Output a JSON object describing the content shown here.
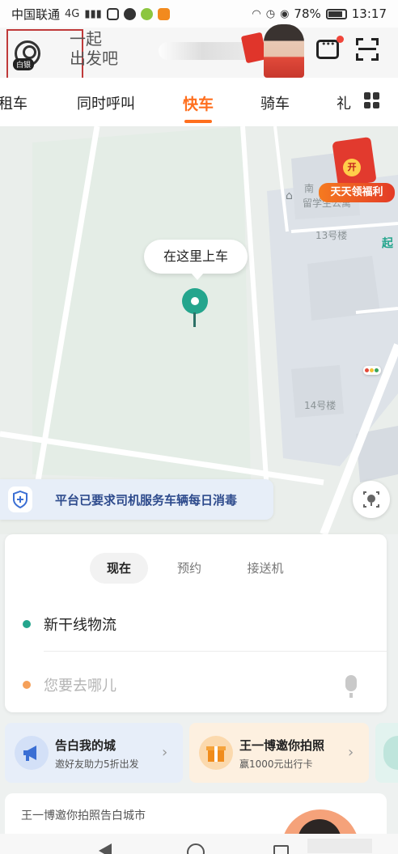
{
  "status_bar": {
    "carrier": "中国联通",
    "network": "4G",
    "battery": "78%",
    "time": "13:17"
  },
  "header": {
    "avatar_badge": "白银",
    "slogan_line1": "一起",
    "slogan_line2": "出发吧"
  },
  "tabs": {
    "items": [
      "租车",
      "同时呼叫",
      "快车",
      "骑车",
      "礼"
    ],
    "active": "快车"
  },
  "map": {
    "welfare_coin": "开",
    "welfare_label": "天天领福利",
    "building_label_1a": "南",
    "building_label_1b": "留学生公寓",
    "building_label_2": "13号楼",
    "building_label_3": "14号楼",
    "start_label": "起",
    "pickup_bubble": "在这里上车",
    "notice_text": "平台已要求司机服务车辆每日消毒"
  },
  "booking": {
    "modes": [
      "现在",
      "预约",
      "接送机"
    ],
    "active_mode": "现在",
    "origin": "新干线物流",
    "destination_placeholder": "您要去哪儿"
  },
  "promos": [
    {
      "title": "告白我的城",
      "subtitle": "邀好友助力5折出发",
      "icon": "megaphone-icon"
    },
    {
      "title": "王一博邀你拍照",
      "subtitle": "赢1000元出行卡",
      "icon": "gift-icon"
    }
  ],
  "feed": {
    "title": "王一博邀你拍照告白城市"
  },
  "colors": {
    "accent": "#ff6f1e",
    "pin": "#24a58d",
    "notice_text": "#2d4a8c",
    "origin_dot": "#24a58d",
    "destination_dot": "#f5a05a"
  }
}
